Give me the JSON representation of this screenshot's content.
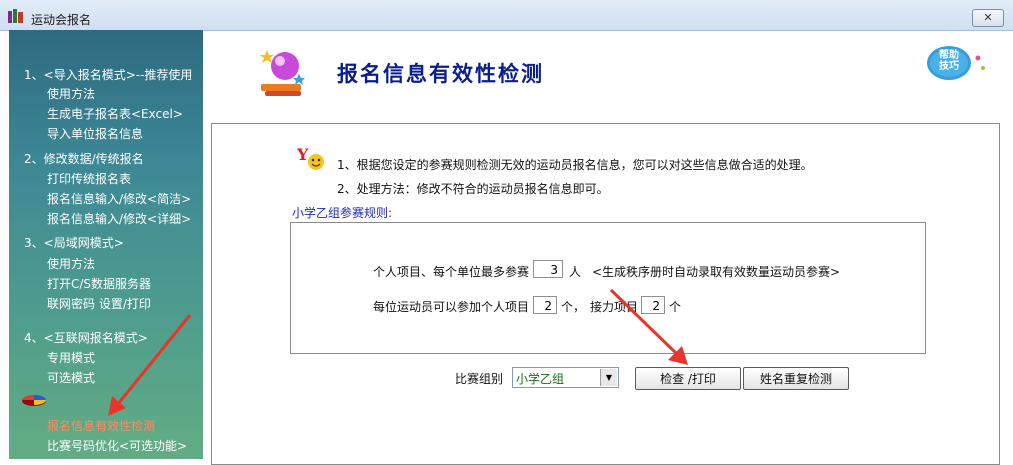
{
  "window": {
    "title": "运动会报名",
    "close_label": "✕"
  },
  "sidebar": {
    "items": [
      {
        "label": "1、<导入报名模式>--推荐使用",
        "level": "header"
      },
      {
        "label": "使用方法",
        "level": "sub"
      },
      {
        "label": "生成电子报名表<Excel>",
        "level": "sub"
      },
      {
        "label": "导入单位报名信息",
        "level": "sub"
      },
      {
        "label": "2、修改数据/传统报名",
        "level": "header"
      },
      {
        "label": "打印传统报名表",
        "level": "sub"
      },
      {
        "label": "报名信息输入/修改<简洁>",
        "level": "sub"
      },
      {
        "label": "报名信息输入/修改<详细>",
        "level": "sub"
      },
      {
        "label": "3、<局域网模式>",
        "level": "header"
      },
      {
        "label": "使用方法",
        "level": "sub"
      },
      {
        "label": "打开C/S数据服务器",
        "level": "sub"
      },
      {
        "label": "联网密码 设置/打印",
        "level": "sub"
      },
      {
        "label": "4、<互联网报名模式>",
        "level": "header"
      },
      {
        "label": "专用模式",
        "level": "sub"
      },
      {
        "label": "可选模式",
        "level": "sub"
      },
      {
        "label": "报名信息有效性检测",
        "level": "sub",
        "active": true
      },
      {
        "label": "比赛号码优化<可选功能>",
        "level": "sub"
      }
    ],
    "active_color": "#ff8a63"
  },
  "header": {
    "title": "报名信息有效性检测",
    "help_label": "帮助技巧"
  },
  "info": {
    "line1": "1、根据您设定的参赛规则检测无效的运动员报名信息，您可以对这些信息做合适的处理。",
    "line2": "2、处理方法：修改不符合的运动员报名信息即可。"
  },
  "rules": {
    "title": "小学乙组参赛规则:",
    "row1_prefix": "个人项目、每个单位最多参赛",
    "row1_value": "3",
    "row1_unit": "人",
    "row1_note": "<生成秩序册时自动录取有效数量运动员参赛>",
    "row2_prefix": "每位运动员可以参加个人项目",
    "row2_value1": "2",
    "row2_unit1": "个，",
    "row2_mid": "接力项目",
    "row2_value2": "2",
    "row2_unit2": "个"
  },
  "controls": {
    "group_label": "比赛组别",
    "group_selected": "小学乙组",
    "check_print_button": "检查 /打印",
    "duplicate_check_button": "姓名重复检测"
  },
  "colors": {
    "title_blue": "#0a1e8c",
    "annotation_red": "#e8352a",
    "sidebar_teal": "#3c8795"
  }
}
